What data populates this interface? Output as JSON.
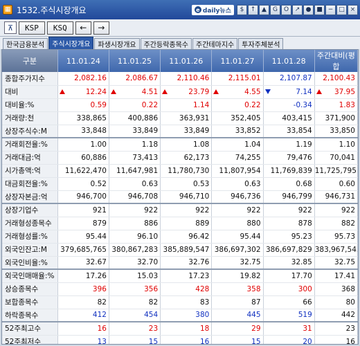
{
  "window": {
    "title": "1532.주식시장개요",
    "brand": "daily뉴스",
    "brand_e": "e"
  },
  "titlebar_buttons": [
    "$",
    "↑",
    "▲",
    "G",
    "O",
    "↗",
    "●",
    "■",
    "−",
    "□",
    "×"
  ],
  "toolbar": {
    "icon": "⊼",
    "btn1": "KSP",
    "btn2": "KSQ",
    "prev": "←",
    "next": "→"
  },
  "tabs": [
    "한국금융분석",
    "주식시장개요",
    "파생시장개요",
    "주간등락종목수",
    "주간테마지수",
    "투자주체분석"
  ],
  "active_tab": 1,
  "table": {
    "headers": [
      "구분",
      "11.01.24",
      "11.01.25",
      "11.01.26",
      "11.01.27",
      "11.01.28",
      "주간대비(평합"
    ],
    "rows": [
      {
        "label": "종합주가지수",
        "cells": [
          "2,082.16",
          "2,086.67",
          "2,110.46",
          "2,115.01",
          "2,107.87",
          "2,100.43"
        ],
        "colors": [
          "red",
          "red",
          "red",
          "red",
          "blue",
          "red"
        ]
      },
      {
        "label": "대비",
        "cells": [
          "12.24",
          "4.51",
          "23.79",
          "4.55",
          "7.14",
          "37.95"
        ],
        "colors": [
          "red",
          "red",
          "red",
          "red",
          "blue",
          "red"
        ],
        "arrows": [
          "up",
          "up",
          "up",
          "up",
          "down",
          "up"
        ]
      },
      {
        "label": "대비율:%",
        "cells": [
          "0.59",
          "0.22",
          "1.14",
          "0.22",
          "-0.34",
          "1.83"
        ],
        "colors": [
          "red",
          "red",
          "red",
          "red",
          "blue",
          "red"
        ]
      },
      {
        "label": "거래량:천",
        "cells": [
          "338,865",
          "400,886",
          "363,931",
          "352,405",
          "403,415",
          "371,900"
        ]
      },
      {
        "label": "상장주식수:M",
        "cells": [
          "33,848",
          "33,849",
          "33,849",
          "33,852",
          "33,854",
          "33,850"
        ]
      },
      {
        "label": "거래회전율:%",
        "cells": [
          "1.00",
          "1.18",
          "1.08",
          "1.04",
          "1.19",
          "1.10"
        ],
        "group": true
      },
      {
        "label": "거래대금:억",
        "cells": [
          "60,886",
          "73,413",
          "62,173",
          "74,255",
          "79,476",
          "70,041"
        ]
      },
      {
        "label": "시가총액:억",
        "cells": [
          "11,622,470",
          "11,647,981",
          "11,780,730",
          "11,807,954",
          "11,769,839",
          "11,725,795"
        ]
      },
      {
        "label": "대금회전율:%",
        "cells": [
          "0.52",
          "0.63",
          "0.53",
          "0.63",
          "0.68",
          "0.60"
        ]
      },
      {
        "label": "상장자본금:억",
        "cells": [
          "946,700",
          "946,708",
          "946,710",
          "946,736",
          "946,799",
          "946,731"
        ]
      },
      {
        "label": "상장기업수",
        "cells": [
          "921",
          "922",
          "922",
          "922",
          "922",
          "922"
        ],
        "group": true
      },
      {
        "label": "거래형성종목수",
        "cells": [
          "879",
          "886",
          "889",
          "880",
          "878",
          "882"
        ]
      },
      {
        "label": "거래형성률:%",
        "cells": [
          "95.44",
          "96.10",
          "96.42",
          "95.44",
          "95.23",
          "95.73"
        ]
      },
      {
        "label": "외국인잔고:M",
        "cells": [
          "379,685,765",
          "380,867,283",
          "385,889,547",
          "386,697,302",
          "386,697,829",
          "383,967,545"
        ]
      },
      {
        "label": "외국인비율:%",
        "cells": [
          "32.67",
          "32.70",
          "32.76",
          "32.75",
          "32.85",
          "32.75"
        ]
      },
      {
        "label": "외국인매매율:%",
        "cells": [
          "17.26",
          "15.03",
          "17.23",
          "19.82",
          "17.70",
          "17.41"
        ],
        "group": true
      },
      {
        "label": "상승종목수",
        "cells": [
          "396",
          "356",
          "428",
          "358",
          "300",
          "368"
        ],
        "colors": [
          "red",
          "red",
          "red",
          "red",
          "red",
          ""
        ]
      },
      {
        "label": "보합종목수",
        "cells": [
          "82",
          "82",
          "83",
          "87",
          "66",
          "80"
        ]
      },
      {
        "label": "하락종목수",
        "cells": [
          "412",
          "454",
          "380",
          "445",
          "519",
          "442"
        ],
        "colors": [
          "blue",
          "blue",
          "blue",
          "blue",
          "blue",
          ""
        ]
      },
      {
        "label": "52주최고수",
        "cells": [
          "16",
          "23",
          "18",
          "29",
          "31",
          "23"
        ],
        "colors": [
          "red",
          "red",
          "red",
          "red",
          "red",
          ""
        ],
        "group": true
      },
      {
        "label": "52주최저수",
        "cells": [
          "13",
          "15",
          "16",
          "15",
          "20",
          "16"
        ],
        "colors": [
          "blue",
          "blue",
          "blue",
          "blue",
          "blue",
          ""
        ]
      }
    ]
  }
}
